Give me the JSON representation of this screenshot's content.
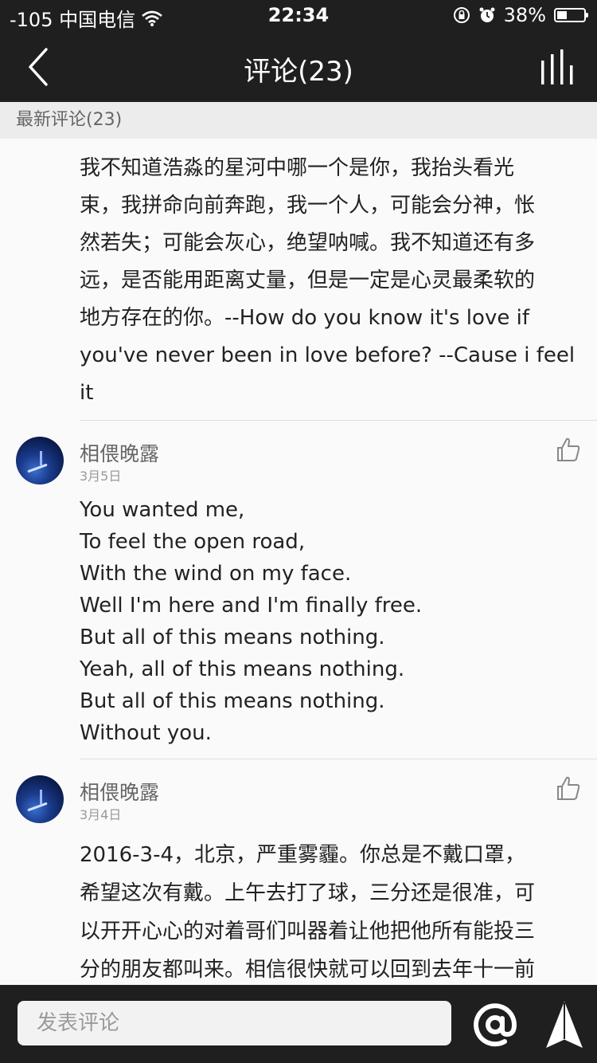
{
  "status_bar": {
    "carrier": "-105 中国电信",
    "time": "22:34",
    "battery": "38%",
    "battery_level": 0.38
  },
  "nav": {
    "title": "评论(23)",
    "back_icon": "chevron-left-icon",
    "menu_icon": "bars-icon"
  },
  "section": {
    "label": "最新评论(23)"
  },
  "comments": [
    {
      "text": "我不知道浩淼的星河中哪一个是你，我抬头看光\n束，我拼命向前奔跑，我一个人，可能会分神，怅\n然若失；可能会灰心，绝望呐喊。我不知道还有多\n远，是否能用距离丈量，但是一定是心灵最柔软的\n地方存在的你。--How do you know it's love if\nyou've never been in love before? --Cause i feel\nit"
    },
    {
      "user": "相偎晚露",
      "date": "3月5日",
      "text": "You wanted me,\nTo feel the open road,\nWith the wind on my face.\nWell I'm here and I'm finally free.\nBut all of this means nothing.\nYeah, all of this means nothing.\nBut all of this means nothing.\nWithout you."
    },
    {
      "user": "相偎晚露",
      "date": "3月4日",
      "text": "2016-3-4，北京，严重雾霾。你总是不戴口罩，\n希望这次有戴。上午去打了球，三分还是很准，可\n以开开心心的对着哥们叫器着让他把他所有能投三\n分的朋友都叫来。相信很快就可以回到去年十一前"
    }
  ],
  "bottom_bar": {
    "placeholder": "发表评论",
    "at_icon": "at-icon",
    "send_icon": "send-icon"
  }
}
